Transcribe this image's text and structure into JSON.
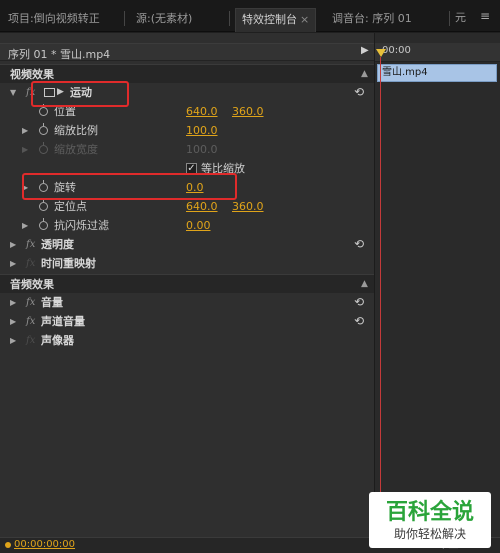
{
  "tabs": [
    {
      "label": "项目:倒向视频转正"
    },
    {
      "label": "源:(无素材)"
    },
    {
      "label": "特效控制台",
      "close": "×"
    },
    {
      "label": "调音台: 序列 01"
    },
    {
      "label": "元"
    }
  ],
  "tab_menu_icon": "≡",
  "sequence": {
    "title": "序列 01 * 雪山.mp4",
    "ruler_time": "00:00",
    "clip_name": "雪山.mp4"
  },
  "video_effects": {
    "header": "视频效果",
    "motion": {
      "label": "运动",
      "position": {
        "label": "位置",
        "x": "640.0",
        "y": "360.0"
      },
      "scale": {
        "label": "缩放比例",
        "value": "100.0"
      },
      "scale_width": {
        "label": "缩放宽度",
        "value": "100.0"
      },
      "uniform_scale": {
        "label": "等比缩放",
        "checked": true
      },
      "rotation": {
        "label": "旋转",
        "value": "0.0"
      },
      "anchor": {
        "label": "定位点",
        "x": "640.0",
        "y": "360.0"
      },
      "antiflicker": {
        "label": "抗闪烁过滤",
        "value": "0.00"
      }
    },
    "opacity": {
      "label": "透明度"
    },
    "time_remap": {
      "label": "时间重映射"
    }
  },
  "audio_effects": {
    "header": "音频效果",
    "volume": {
      "label": "音量"
    },
    "channel_volume": {
      "label": "声道音量"
    },
    "panner": {
      "label": "声像器"
    }
  },
  "footer": {
    "timecode": "00:00:00:00"
  },
  "watermark": {
    "main": "百科全说",
    "sub": "助你轻松解决"
  },
  "colors": {
    "accent_value": "#e0a41a",
    "highlight": "#e02b2b",
    "clip": "#a8c4e6",
    "playhead": "#c43a3a",
    "watermark_green": "#2aa43a"
  },
  "icons": [
    "stopwatch-icon",
    "fx-icon",
    "motion-icon",
    "reset-icon",
    "checkbox-icon",
    "chevron-right-icon",
    "close-icon",
    "panel-menu-icon"
  ]
}
